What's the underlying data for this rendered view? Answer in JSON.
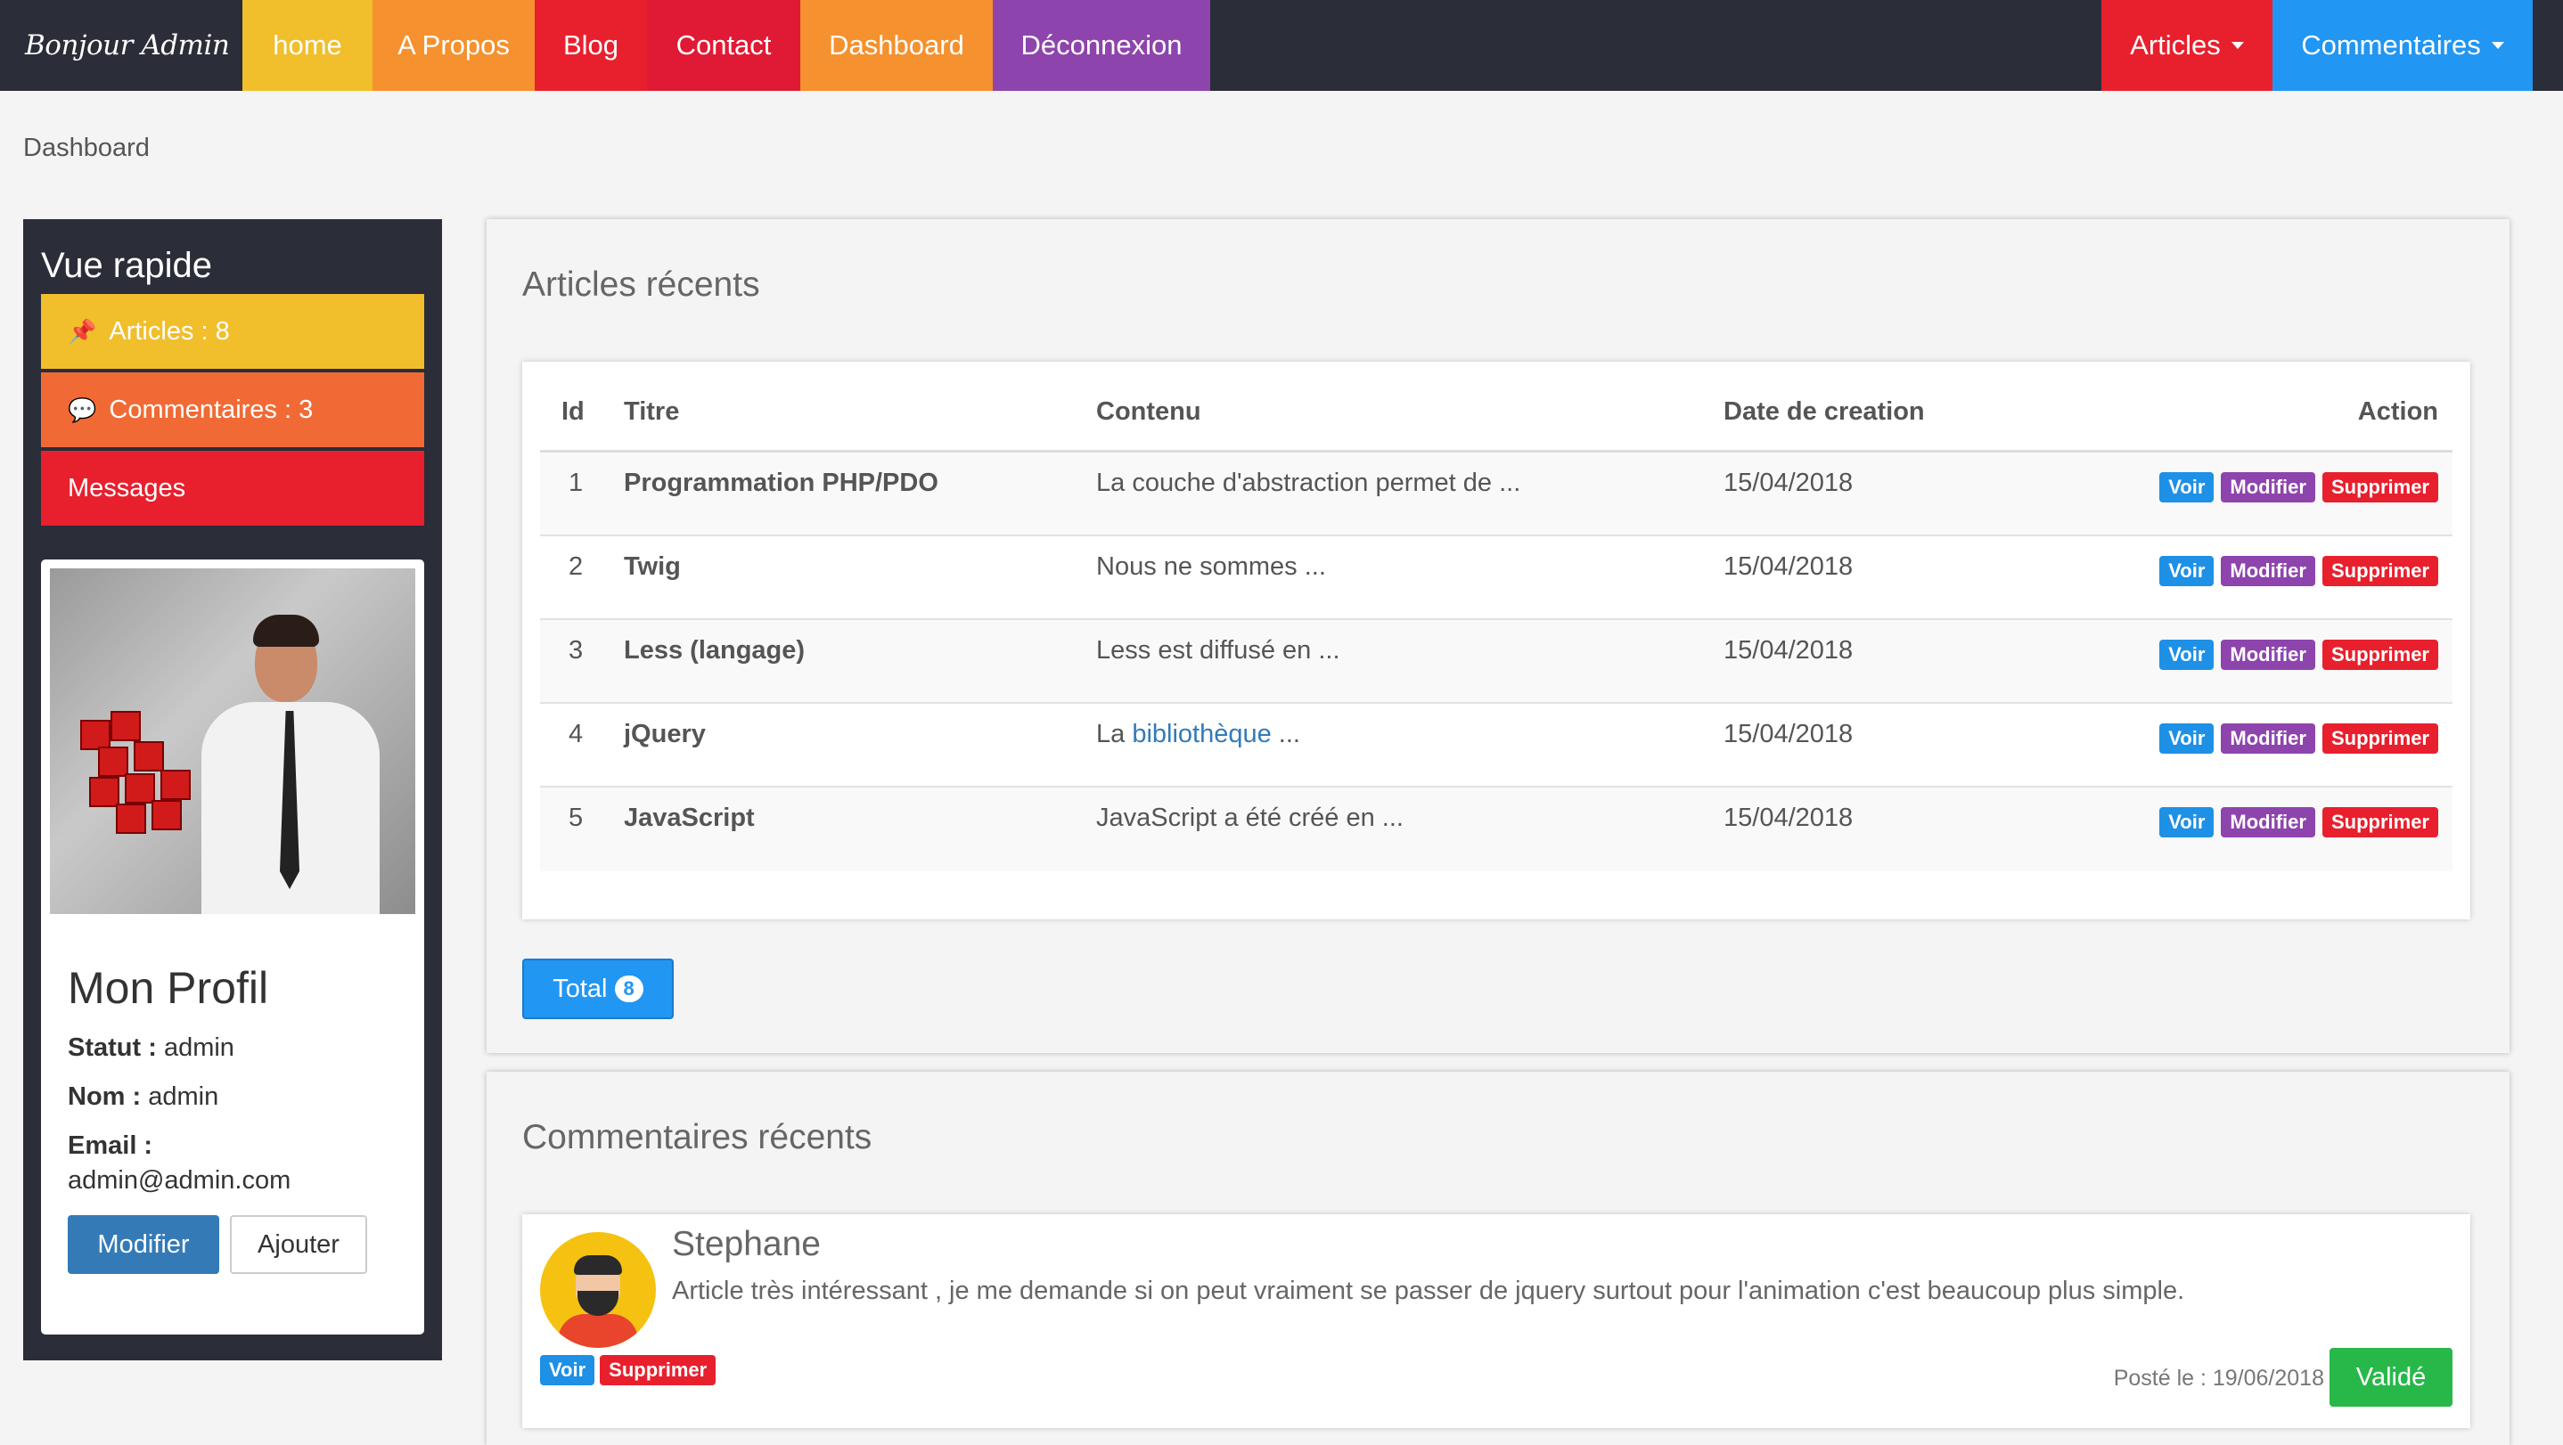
{
  "navbar": {
    "brand": "Bonjour Admin",
    "items": [
      {
        "label": "home",
        "color": "#f1be2c"
      },
      {
        "label": "A Propos",
        "color": "#f5912e"
      },
      {
        "label": "Blog",
        "color": "#e8202e"
      },
      {
        "label": "Contact",
        "color": "#e01a35"
      },
      {
        "label": "Dashboard",
        "color": "#f5912e"
      },
      {
        "label": "Déconnexion",
        "color": "#8e44ad"
      }
    ],
    "right_items": [
      {
        "label": "Articles",
        "color": "#e8202e"
      },
      {
        "label": "Commentaires",
        "color": "#2196f3"
      }
    ]
  },
  "breadcrumb": "Dashboard",
  "sidebar": {
    "title": "Vue rapide",
    "items": [
      {
        "label": "Articles : 8",
        "icon": "pin-icon",
        "color": "#f1be2c"
      },
      {
        "label": "Commentaires : 3",
        "icon": "comments-icon",
        "color": "#f16a35"
      },
      {
        "label": "Messages",
        "color": "#e8202e"
      }
    ],
    "profile": {
      "name": "Mon Profil",
      "statut_label": "Statut :",
      "statut": "admin",
      "nom_label": "Nom :",
      "nom": "admin",
      "email_label": "Email :",
      "email": "admin@admin.com",
      "modifier": "Modifier",
      "ajouter": "Ajouter"
    }
  },
  "articles": {
    "title": "Articles récents",
    "headers": {
      "id": "Id",
      "titre": "Titre",
      "contenu": "Contenu",
      "date": "Date de creation",
      "action": "Action"
    },
    "rows": [
      {
        "id": "1",
        "titre": "Programmation PHP/PDO",
        "contenu": "La couche d'abstraction permet de ...",
        "date": "15/04/2018"
      },
      {
        "id": "2",
        "titre": "Twig",
        "contenu": "Nous ne sommes ...",
        "date": "15/04/2018"
      },
      {
        "id": "3",
        "titre": "Less (langage)",
        "contenu": "Less est diffusé en ...",
        "date": "15/04/2018"
      },
      {
        "id": "4",
        "titre": "jQuery",
        "contenu_pre": "La ",
        "contenu_link": "bibliothèque",
        "contenu_post": " ...",
        "date": "15/04/2018"
      },
      {
        "id": "5",
        "titre": "JavaScript",
        "contenu": "JavaScript a été créé en ...",
        "date": "15/04/2018"
      }
    ],
    "action_labels": {
      "voir": "Voir",
      "modifier": "Modifier",
      "supprimer": "Supprimer"
    },
    "total_label": "Total",
    "total_count": "8"
  },
  "comments": {
    "title": "Commentaires récents",
    "items": [
      {
        "author": "Stephane",
        "text": "Article très intéressant , je me demande si on peut vraiment se passer de jquery surtout pour l'animation c'est beaucoup plus simple.",
        "voir": "Voir",
        "supprimer": "Supprimer",
        "date": "Posté le : 19/06/2018",
        "status": "Validé"
      }
    ]
  }
}
